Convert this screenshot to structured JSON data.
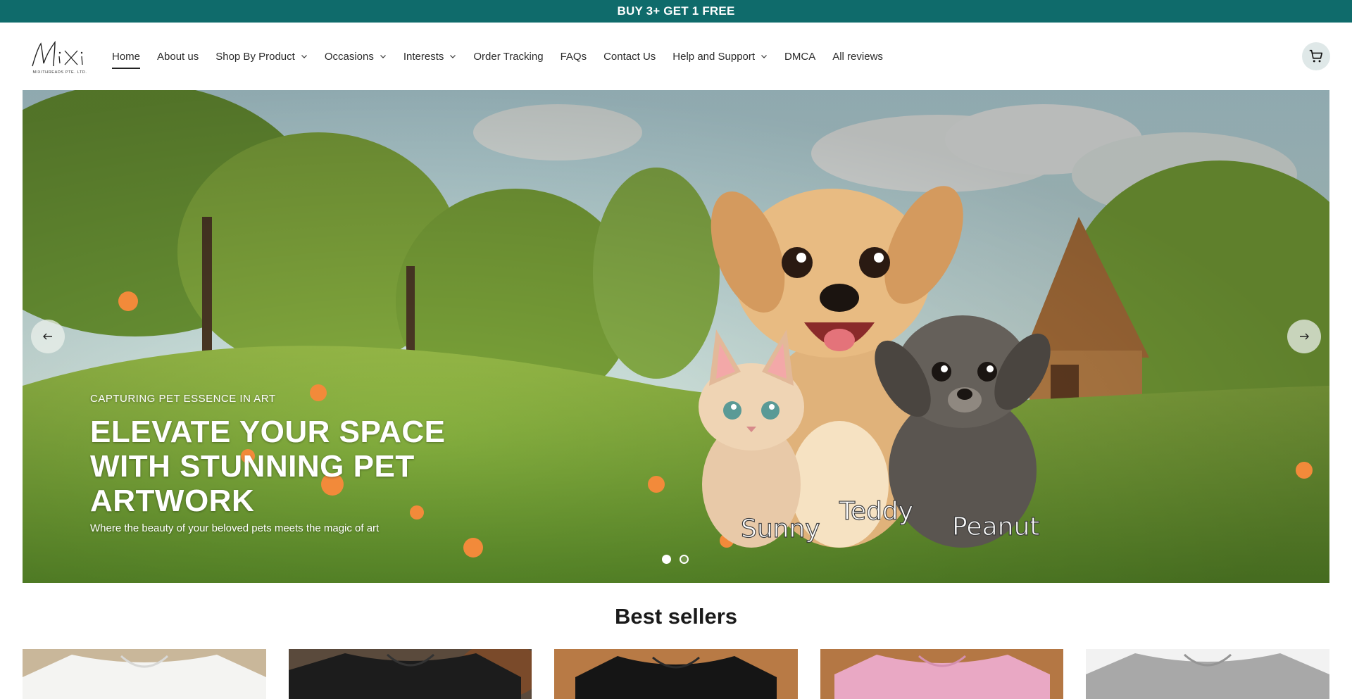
{
  "announcement": "BUY 3+ GET 1 FREE",
  "brand": {
    "logo_text": "MiXi",
    "logo_subtext": "MIXITHREADS PTE. LTD."
  },
  "nav": {
    "items": [
      {
        "label": "Home",
        "active": true,
        "has_dropdown": false
      },
      {
        "label": "About us",
        "has_dropdown": false
      },
      {
        "label": "Shop By Product",
        "has_dropdown": true
      },
      {
        "label": "Occasions",
        "has_dropdown": true
      },
      {
        "label": "Interests",
        "has_dropdown": true
      },
      {
        "label": "Order Tracking",
        "has_dropdown": false
      },
      {
        "label": "FAQs",
        "has_dropdown": false
      },
      {
        "label": "Contact Us",
        "has_dropdown": false
      },
      {
        "label": "Help and Support",
        "has_dropdown": true
      },
      {
        "label": "DMCA",
        "has_dropdown": false
      },
      {
        "label": "All reviews",
        "has_dropdown": false
      }
    ]
  },
  "cart": {
    "icon": "cart-icon"
  },
  "hero": {
    "subheading": "CAPTURING PET ESSENCE IN ART",
    "title": "ELEVATE YOUR SPACE WITH STUNNING PET ARTWORK",
    "description": "Where the beauty of your beloved pets meets the magic of art",
    "pet_names": [
      "Sunny",
      "Teddy",
      "Peanut"
    ],
    "prev_icon": "arrow-left-icon",
    "next_icon": "arrow-right-icon",
    "slide_count": 2,
    "active_slide": 1
  },
  "best_sellers": {
    "title": "Best sellers",
    "products": [
      {
        "shirt_color": "#f4f4f2",
        "background": "#c9b79a"
      },
      {
        "shirt_color": "#1c1c1c",
        "background": "#5a4a3c"
      },
      {
        "shirt_color": "#151515",
        "background": "#b87a45"
      },
      {
        "shirt_color": "#e9a8c4",
        "background": "#b47744"
      },
      {
        "shirt_color": "#a8a8a8",
        "background": "#f2f2f2"
      }
    ]
  },
  "colors": {
    "announcement_bg": "#0f6b6b",
    "cart_bg": "#dfe8e8"
  }
}
